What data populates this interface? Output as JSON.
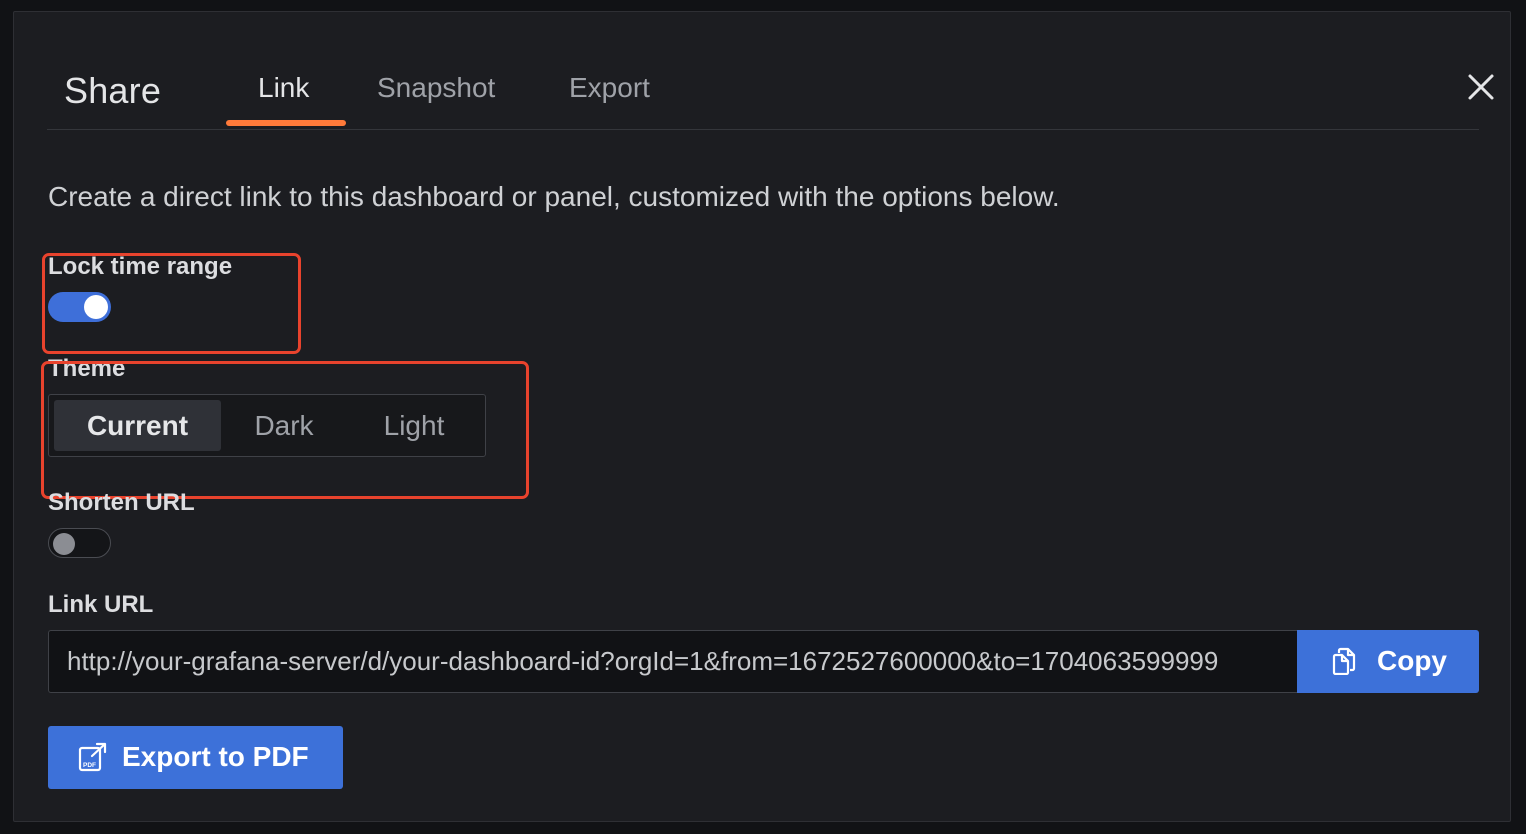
{
  "modal": {
    "title": "Share",
    "tabs": [
      {
        "label": "Link",
        "active": true
      },
      {
        "label": "Snapshot",
        "active": false
      },
      {
        "label": "Export",
        "active": false
      }
    ],
    "close_icon": "close-icon"
  },
  "link_tab": {
    "description": "Create a direct link to this dashboard or panel, customized with the options below.",
    "lock_time_range": {
      "label": "Lock time range",
      "enabled": true
    },
    "theme": {
      "label": "Theme",
      "options": [
        "Current",
        "Dark",
        "Light"
      ],
      "selected": "Current"
    },
    "shorten_url": {
      "label": "Shorten URL",
      "enabled": false
    },
    "link_url": {
      "label": "Link URL",
      "value": "http://your-grafana-server/d/your-dashboard-id?orgId=1&from=1672527600000&to=1704063599999"
    },
    "copy_button": {
      "label": "Copy",
      "icon": "copy-icon"
    },
    "export_pdf_button": {
      "label": "Export to PDF",
      "icon": "pdf-export-icon"
    }
  },
  "colors": {
    "accent": "#3d71d9",
    "tab_underline": "#ff7a3a",
    "highlight_box": "#e8432d",
    "background": "#1c1d21"
  }
}
